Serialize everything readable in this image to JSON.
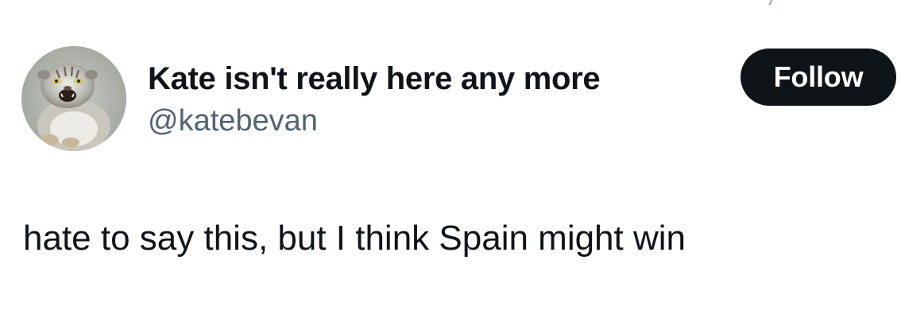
{
  "user": {
    "display_name": "Kate isn't really here any more",
    "handle": "@katebevan",
    "avatar_icon": "pallas-cat-avatar"
  },
  "actions": {
    "follow_label": "Follow"
  },
  "tweet": {
    "text": "hate to say this, but I think Spain might win"
  },
  "colors": {
    "text_primary": "#0f1419",
    "text_secondary": "#536471",
    "follow_bg": "#0f1419",
    "follow_text": "#ffffff",
    "background": "#ffffff"
  }
}
